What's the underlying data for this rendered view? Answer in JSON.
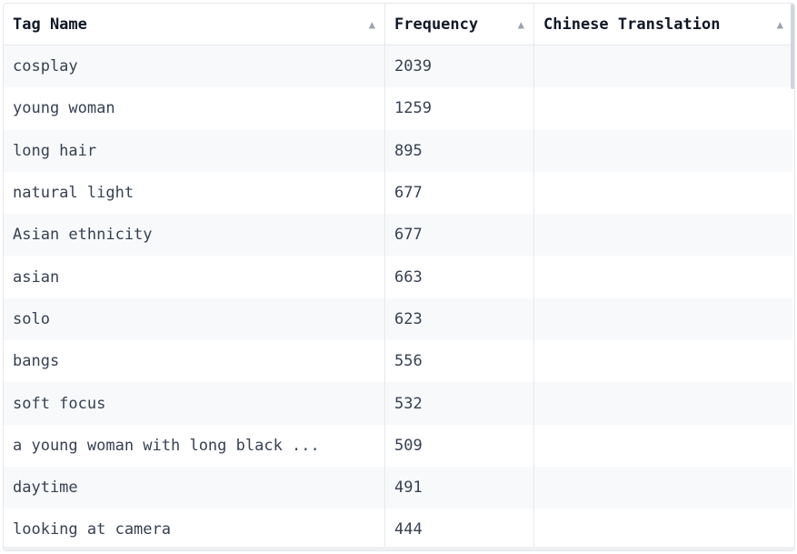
{
  "table": {
    "columns": [
      {
        "label": "Tag Name"
      },
      {
        "label": "Frequency"
      },
      {
        "label": "Chinese Translation"
      }
    ],
    "rows": [
      {
        "tag": "cosplay",
        "freq": "2039",
        "zh": ""
      },
      {
        "tag": "young woman",
        "freq": "1259",
        "zh": ""
      },
      {
        "tag": "long hair",
        "freq": "895",
        "zh": ""
      },
      {
        "tag": "natural light",
        "freq": "677",
        "zh": ""
      },
      {
        "tag": "Asian ethnicity",
        "freq": "677",
        "zh": ""
      },
      {
        "tag": "asian",
        "freq": "663",
        "zh": ""
      },
      {
        "tag": "solo",
        "freq": "623",
        "zh": ""
      },
      {
        "tag": "bangs",
        "freq": "556",
        "zh": ""
      },
      {
        "tag": "soft focus",
        "freq": "532",
        "zh": ""
      },
      {
        "tag": "a young woman with long black ...",
        "freq": "509",
        "zh": ""
      },
      {
        "tag": "daytime",
        "freq": "491",
        "zh": ""
      },
      {
        "tag": "looking at camera",
        "freq": "444",
        "zh": ""
      }
    ]
  }
}
